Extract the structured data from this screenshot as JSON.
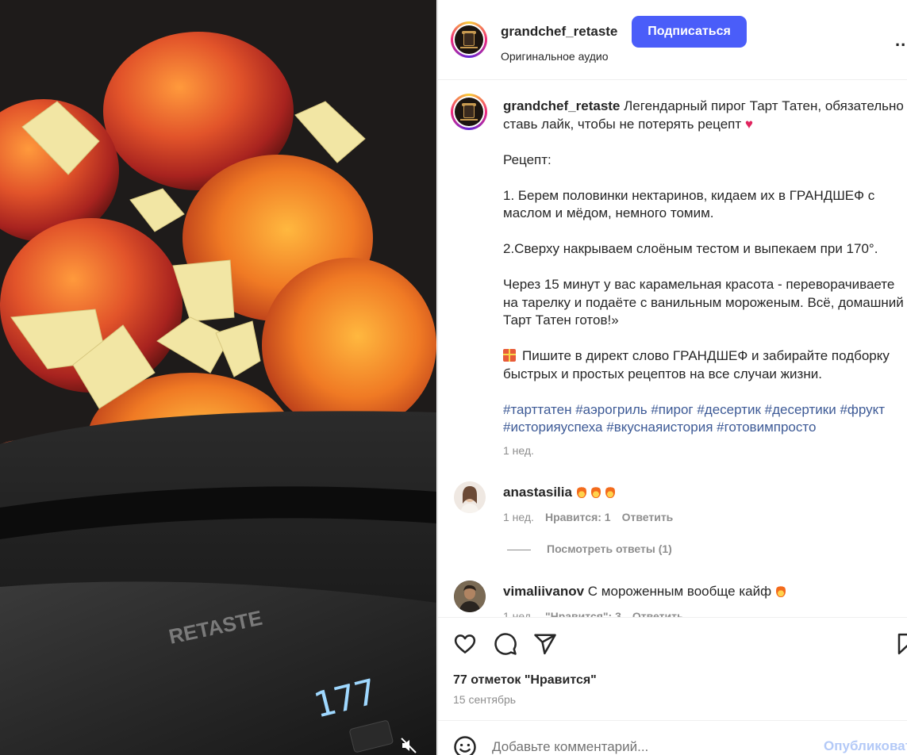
{
  "post": {
    "username": "grandchef_retaste",
    "follow_label": "Подписаться",
    "audio_label": "Оригинальное аудио",
    "more_label": "..."
  },
  "caption": {
    "username": "grandchef_retaste",
    "intro": "Легендарный пирог Тарт Татен, обязательно ставь лайк, чтобы не потерять рецепт",
    "heart": "♥",
    "recipe_title": "Рецепт:",
    "step1": "1. Берем половинки нектаринов, кидаем их в ГРАНДШЕФ с маслом и мёдом, немного томим.",
    "step2": "2.Сверху накрываем слоёным тестом и выпекаем при 170°.",
    "step3": "Через 15 минут у вас карамельная красота - переворачиваете на тарелку и подаёте с ванильным мороженым. Всё, домашний Тарт Татен готов!»",
    "promo": "Пишите в директ слово ГРАНДШЕФ и забирайте подборку быстрых и простых рецептов на все случаи жизни.",
    "hashtags": "#тарттатен #аэрогриль #пирог #десертик #десертики #фрукт #историяуспеха #вкуснаяистория #готовимпросто",
    "time": "1 нед."
  },
  "comments": [
    {
      "username": "anastasilia",
      "text": "",
      "time": "1 нед.",
      "likes": "Нравится: 1",
      "reply": "Ответить",
      "view_replies": "Посмотреть ответы (1)"
    },
    {
      "username": "vimaliivanov",
      "text": "С мороженным вообще кайф",
      "time": "1 нед.",
      "likes": "\"Нравится\": 3",
      "reply": "Ответить"
    }
  ],
  "stats": {
    "likes": "77 отметок \"Нравится\"",
    "date": "15 сентябрь"
  },
  "comment_bar": {
    "placeholder": "Добавьте комментарий...",
    "publish": "Опубликовать"
  },
  "colors": {
    "follow_button": "#4a5df9",
    "hashtag": "#3d5a96",
    "muted_text": "#8e8e8e",
    "publish_disabled": "#b3c9f7"
  },
  "icons": [
    "like-icon",
    "comment-icon",
    "share-icon",
    "bookmark-icon",
    "emoji-icon",
    "mute-icon"
  ],
  "media": {
    "device_brand": "RETASTE",
    "display_reading": "177"
  }
}
